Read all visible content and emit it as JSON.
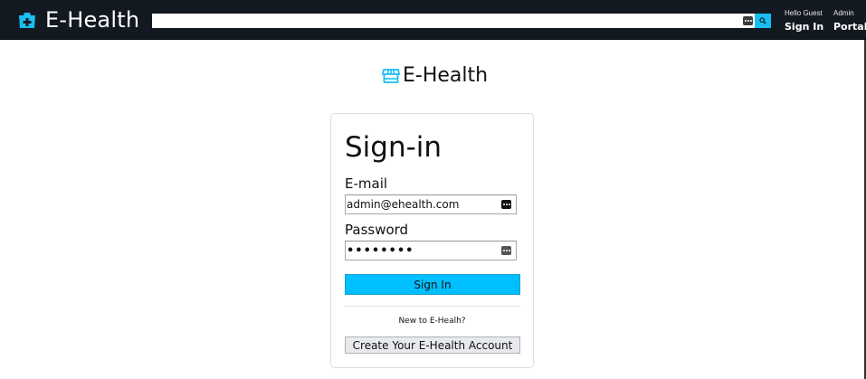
{
  "header": {
    "brand_text": "E-Health",
    "search_value": "",
    "greeting": "Hello Guest",
    "signin_label": "Sign In",
    "admin_label": "Admin",
    "portal_label": "Portal",
    "bg_color": "#131921",
    "accent_color": "#19bdf0"
  },
  "login": {
    "logo_text": "E-Health",
    "title": "Sign-in",
    "email_label": "E-mail",
    "email_value": "admin@ehealth.com",
    "password_label": "Password",
    "password_value": "password",
    "signin_button": "Sign In",
    "new_prompt": "New to E-Healh?",
    "create_button": "Create Your E-Health Account",
    "button_color": "#00bfff"
  },
  "icons": {
    "brand": "medical-cross-bag-icon",
    "logo": "storefront-icon",
    "search": "search-icon",
    "password_manager": "password-key-icon"
  }
}
